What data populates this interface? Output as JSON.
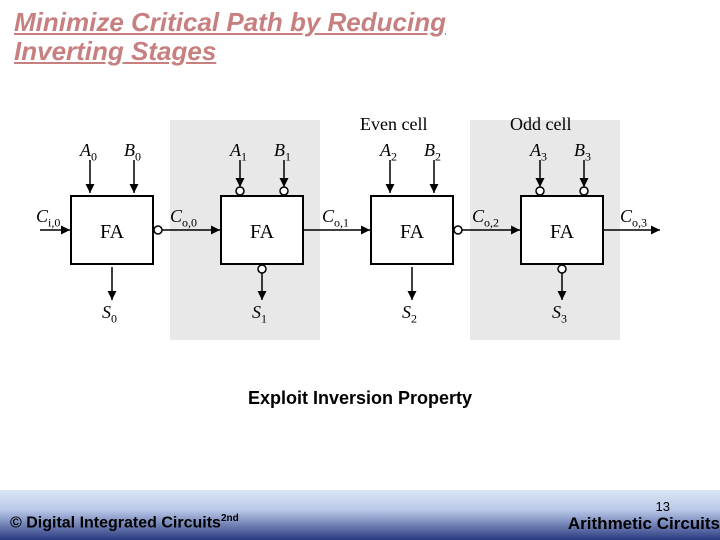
{
  "title_line1": "Minimize Critical Path by Reducing",
  "title_line2": "Inverting Stages",
  "labels": {
    "even_cell": "Even cell",
    "odd_cell": "Odd cell"
  },
  "cells": [
    {
      "A": "A",
      "A_sub": "0",
      "B": "B",
      "B_sub": "0",
      "S": "S",
      "S_sub": "0",
      "FA": "FA",
      "invert_in": false,
      "invert_out": true,
      "carry_in_label": "C",
      "carry_in_sub": "i,0",
      "carry_out_label": "C",
      "carry_out_sub": "o,0"
    },
    {
      "A": "A",
      "A_sub": "1",
      "B": "B",
      "B_sub": "1",
      "S": "S",
      "S_sub": "1",
      "FA": "FA",
      "invert_in": true,
      "invert_out": false,
      "carry_out_label": "C",
      "carry_out_sub": "o,1"
    },
    {
      "A": "A",
      "A_sub": "2",
      "B": "B",
      "B_sub": "2",
      "S": "S",
      "S_sub": "2",
      "FA": "FA",
      "invert_in": false,
      "invert_out": true,
      "carry_out_label": "C",
      "carry_out_sub": "o,2"
    },
    {
      "A": "A",
      "A_sub": "3",
      "B": "B",
      "B_sub": "3",
      "S": "S",
      "S_sub": "3",
      "FA": "FA",
      "invert_in": true,
      "invert_out": false,
      "carry_out_label": "C",
      "carry_out_sub": "o,3"
    }
  ],
  "caption": "Exploit Inversion Property",
  "footer": {
    "copyright_prefix": "© Digital Integrated Circuits",
    "copyright_sup": "2nd",
    "page": "13",
    "topic": "Arithmetic Circuits"
  }
}
